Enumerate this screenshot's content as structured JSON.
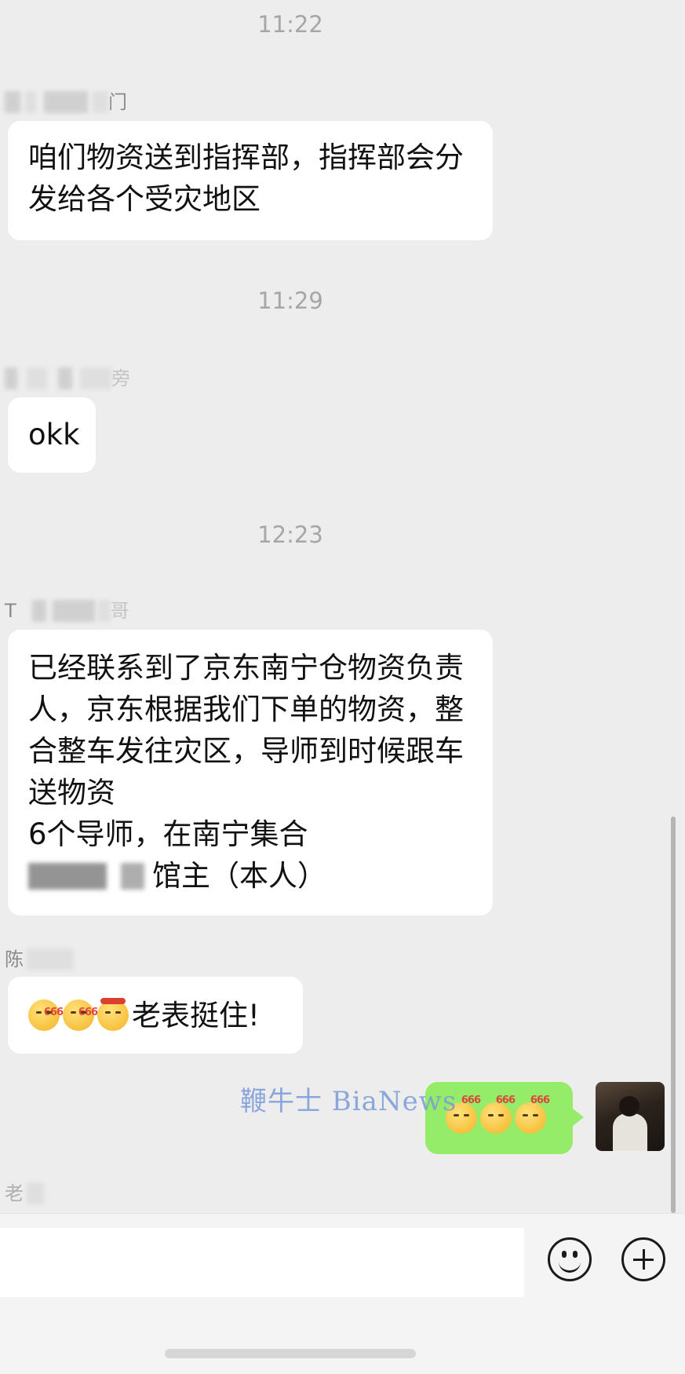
{
  "messages": {
    "ts1": "11:22",
    "sender1_suffix": "门",
    "msg1": [
      "咱们物资送到指挥部，指挥部会分",
      "发给各个受灾地区"
    ],
    "ts2": "11:29",
    "sender2_suffix": "旁",
    "msg2": "okk",
    "ts3": "12:23",
    "sender3_prefix": "T",
    "sender3_suffix": "哥",
    "msg3": [
      "已经联系到了京东南宁仓物资负责",
      "人，京东根据我们下单的物资，整",
      "合整车发往灾区，导师到时候跟车",
      "送物资",
      "6个导师，在南宁集合",
      "馆主（本人）"
    ],
    "sender4_prefix": "陈",
    "msg4_text": "老表挺住!",
    "emoji_tag": "666",
    "sender5_prefix": "老"
  },
  "watermark": "鞭牛士 BiaNews",
  "colors": {
    "background": "#ededed",
    "bubble": "#ffffff",
    "my_bubble": "#95ec69",
    "timestamp": "#a6a6a6"
  }
}
